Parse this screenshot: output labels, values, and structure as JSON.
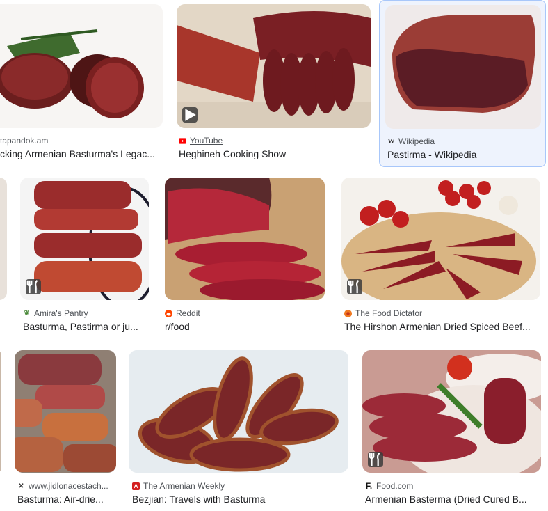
{
  "results": [
    {
      "source": "tapandok.am",
      "title": "cking Armenian Basturma's Legac...",
      "favicon": "none"
    },
    {
      "source": "YouTube",
      "title": "Heghineh Cooking Show",
      "favicon": "youtube-icon",
      "badge": "play-icon"
    },
    {
      "source": "Wikipedia",
      "title": "Pastirma - Wikipedia",
      "favicon": "wikipedia-icon",
      "selected": true
    },
    {
      "source": "Amira's Pantry",
      "title": "Basturma, Pastirma or ju...",
      "favicon": "pantry-icon",
      "badge": "recipe-icon"
    },
    {
      "source": "Reddit",
      "title": "r/food",
      "favicon": "reddit-icon"
    },
    {
      "source": "The Food Dictator",
      "title": "The Hirshon Armenian Dried Spiced Beef...",
      "favicon": "food-dictator-icon",
      "badge": "recipe-icon"
    },
    {
      "source": "www.jidlonacestach...",
      "title": "Basturma: Air-drie...",
      "favicon": "jidlo-icon"
    },
    {
      "source": "The Armenian Weekly",
      "title": "Bezjian: Travels with Basturma",
      "favicon": "armenian-weekly-icon"
    },
    {
      "source": "Food.com",
      "title": "Armenian Basterma (Dried Cured B...",
      "favicon": "foodcom-icon",
      "badge": "recipe-icon"
    }
  ],
  "colors": {
    "accent": "#a8c7fa",
    "selected_bg": "#eef3fd",
    "youtube": "#ff0000",
    "reddit": "#ff4500"
  }
}
